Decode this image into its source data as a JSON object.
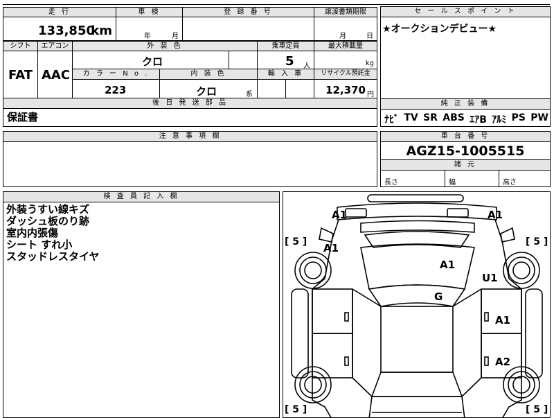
{
  "vehicle": {
    "mileage_header": "走 行",
    "mileage": "133,850",
    "mileage_unit": "km",
    "inspection_header": "車 検",
    "inspection_year": "年",
    "inspection_month": "月",
    "registration_header": "登 録 番 号",
    "transfer_header": "譲渡書類期限",
    "transfer_month": "月",
    "transfer_day": "日",
    "shift_header": "シフト",
    "shift": "FAT",
    "ac_header": "エアコン",
    "ac": "AAC",
    "exterior_header": "外 装 色",
    "exterior_color": "クロ",
    "capacity_header": "乗車定員",
    "capacity": "5",
    "capacity_unit": "人",
    "load_header": "最大積載量",
    "load_unit": "kg",
    "colorno_header": "カ ラ ー N o .",
    "color_no": "223",
    "interior_header": "内 装 色",
    "interior_color": "クロ",
    "interior_suffix": "系",
    "import_header": "輸 入 車",
    "recycle_header": "リサイクル預託金",
    "recycle_fee": "12,370",
    "recycle_unit": "円"
  },
  "sales_point": {
    "header": "セ ー ル ス ポ イ ン ト",
    "text": "★オークションデビュー★"
  },
  "equipment": {
    "header": "純 正 装 備",
    "items": [
      "ﾅﾋﾞ",
      "TV",
      "SR",
      "ABS",
      "ｴｱB",
      "ｱﾙﾐ",
      "PS",
      "PW"
    ]
  },
  "later_parts": {
    "header": "後 日 発 送 部 品",
    "text": "保証書"
  },
  "caution": {
    "header": "注 意 事 項 欄"
  },
  "chassis": {
    "header": "車 台 番 号",
    "number": "AGZ15-1005515"
  },
  "dimensions": {
    "header": "諸 元",
    "length": "長さ",
    "width": "幅",
    "height": "高さ"
  },
  "inspector": {
    "header": "検 査 員 記 入 欄",
    "notes": [
      "外装うすい線キズ",
      "ダッシュ板のり跡",
      "室内内張傷",
      "シート すれ小",
      "スタッドレスタイヤ"
    ]
  },
  "diagram": {
    "marks": [
      "A1",
      "A1",
      "A1",
      "A1",
      "U1",
      "G",
      "A1",
      "A2"
    ],
    "tire_marks": [
      "[ 5 ]",
      "[ 5 ]",
      "[ 5 ]",
      "[ 5 ]"
    ]
  }
}
